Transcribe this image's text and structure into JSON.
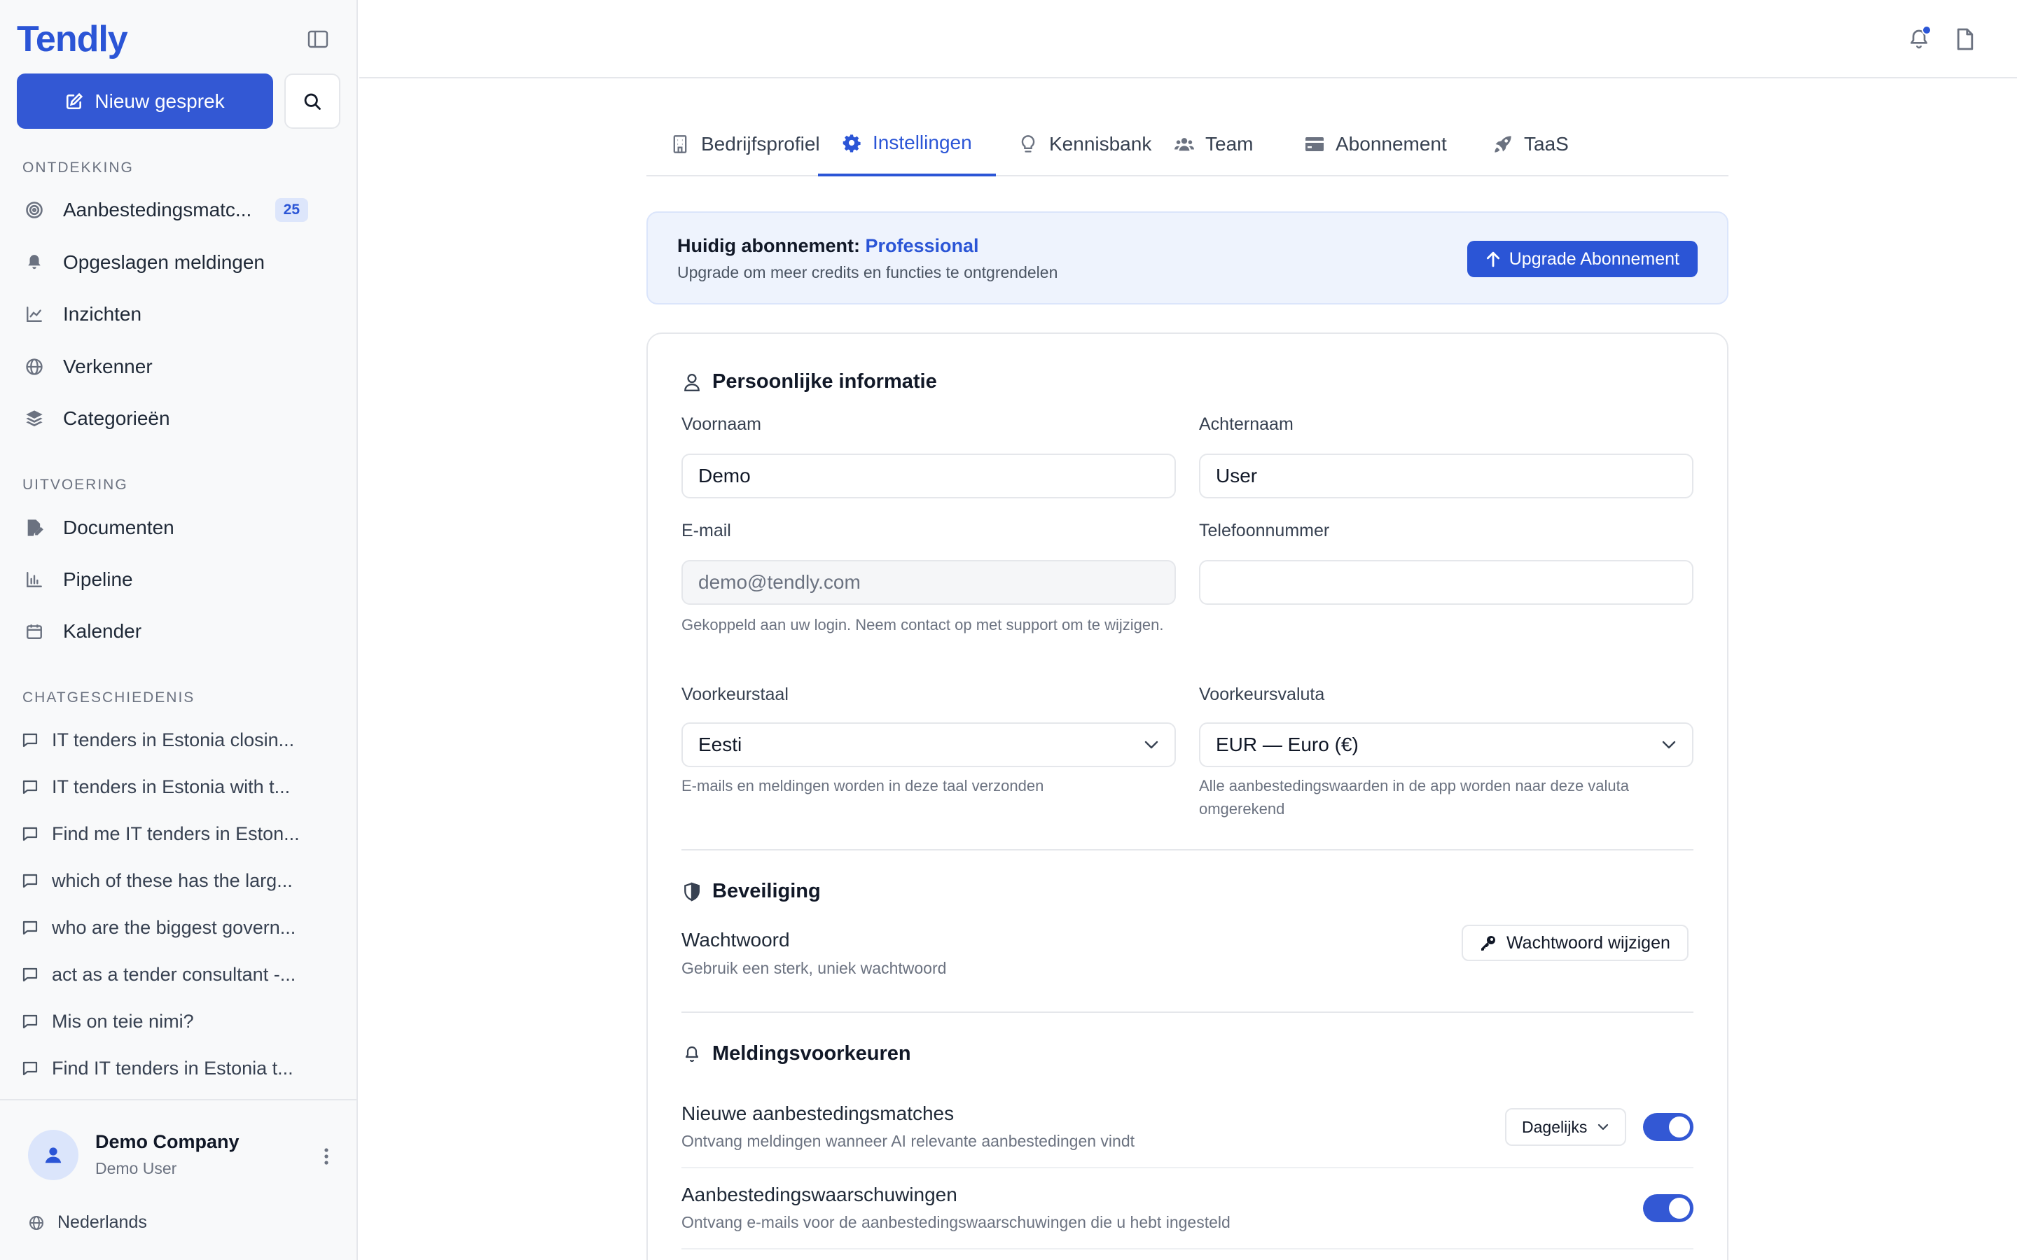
{
  "sidebar": {
    "logo": "Tendly",
    "new_chat_label": "Nieuw gesprek",
    "sections": {
      "discovery": "ONTDEKKING",
      "execution": "UITVOERING",
      "chat_history": "CHATGESCHIEDENIS"
    },
    "discovery_items": [
      {
        "label": "Aanbestedingsmatc...",
        "icon": "target-icon",
        "badge": "25"
      },
      {
        "label": "Opgeslagen meldingen",
        "icon": "bell-icon"
      },
      {
        "label": "Inzichten",
        "icon": "line-chart-icon"
      },
      {
        "label": "Verkenner",
        "icon": "globe-icon"
      },
      {
        "label": "Categorieën",
        "icon": "layers-icon"
      }
    ],
    "execution_items": [
      {
        "label": "Documenten",
        "icon": "file-edit-icon"
      },
      {
        "label": "Pipeline",
        "icon": "bar-chart-icon"
      },
      {
        "label": "Kalender",
        "icon": "calendar-icon"
      }
    ],
    "chats": [
      "IT tenders in Estonia closin...",
      "IT tenders in Estonia with t...",
      "Find me IT tenders in Eston...",
      "which of these has the larg...",
      "who are the biggest govern...",
      "act as a tender consultant -...",
      "Mis on teie nimi?",
      "Find IT tenders in Estonia t..."
    ],
    "footer": {
      "company": "Demo Company",
      "user": "Demo User",
      "language": "Nederlands"
    }
  },
  "tabs": [
    {
      "label": "Bedrijfsprofiel",
      "icon": "building-icon"
    },
    {
      "label": "Instellingen",
      "icon": "gear-icon",
      "active": true
    },
    {
      "label": "Kennisbank",
      "icon": "lightbulb-icon"
    },
    {
      "label": "Team",
      "icon": "users-icon"
    },
    {
      "label": "Abonnement",
      "icon": "credit-card-icon"
    },
    {
      "label": "TaaS",
      "icon": "rocket-icon"
    }
  ],
  "plan": {
    "prefix": "Huidig abonnement: ",
    "name": "Professional",
    "subtitle": "Upgrade om meer credits en functies te ontgrendelen",
    "upgrade_label": "Upgrade Abonnement"
  },
  "personal": {
    "title": "Persoonlijke informatie",
    "first_name_label": "Voornaam",
    "first_name_value": "Demo",
    "last_name_label": "Achternaam",
    "last_name_value": "User",
    "email_label": "E-mail",
    "email_value": "demo@tendly.com",
    "email_hint": "Gekoppeld aan uw login. Neem contact op met support om te wijzigen.",
    "phone_label": "Telefoonnummer",
    "phone_value": "",
    "language_label": "Voorkeurstaal",
    "language_value": "Eesti",
    "language_hint": "E-mails en meldingen worden in deze taal verzonden",
    "currency_label": "Voorkeursvaluta",
    "currency_value": "EUR — Euro (€)",
    "currency_hint": "Alle aanbestedingswaarden in de app worden naar deze valuta omgerekend"
  },
  "security": {
    "title": "Beveiliging",
    "password_label": "Wachtwoord",
    "password_hint": "Gebruik een sterk, uniek wachtwoord",
    "change_label": "Wachtwoord wijzigen"
  },
  "notifications": {
    "title": "Meldingsvoorkeuren",
    "rows": [
      {
        "title": "Nieuwe aanbestedingsmatches",
        "subtitle": "Ontvang meldingen wanneer AI relevante aanbestedingen vindt",
        "frequency": "Dagelijks",
        "enabled": true
      },
      {
        "title": "Aanbestedingswaarschuwingen",
        "subtitle": "Ontvang e-mails voor de aanbestedingswaarschuwingen die u hebt ingesteld",
        "enabled": true
      }
    ]
  },
  "colors": {
    "accent": "#2b55d6",
    "sidebar_bg": "#f8f9fa",
    "plan_bg": "#eef3fd"
  }
}
